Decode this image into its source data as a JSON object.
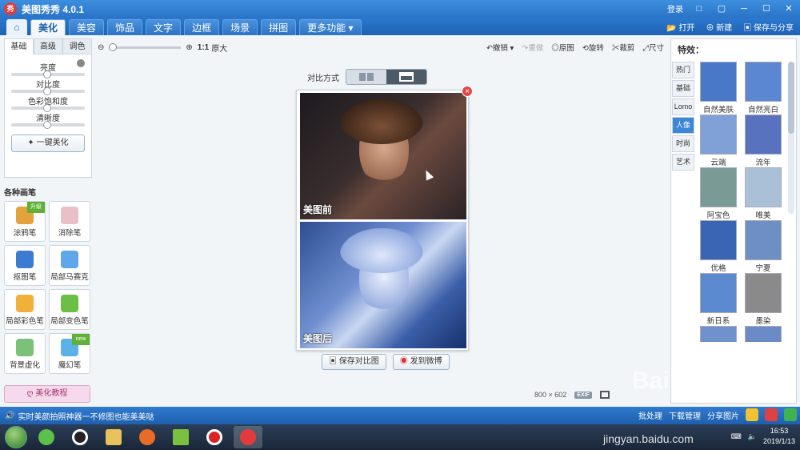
{
  "window": {
    "logo": "秀",
    "title": "美图秀秀 4.0.1",
    "login": "登录",
    "controls": [
      "□",
      "▢",
      "─",
      "☐",
      "✕"
    ]
  },
  "menu": {
    "home_icon": "home-icon",
    "tabs": [
      "美化",
      "美容",
      "饰品",
      "文字",
      "边框",
      "场景",
      "拼图",
      "更多功能"
    ],
    "active_tab": "美化",
    "open": "打开",
    "new": "新建",
    "save_share": "保存与分享"
  },
  "left": {
    "subtabs": [
      "基础",
      "高级",
      "调色"
    ],
    "sliders": [
      {
        "label": "亮度",
        "value": 0.5
      },
      {
        "label": "对比度",
        "value": 0.5
      },
      {
        "label": "色彩饱和度",
        "value": 0.5
      },
      {
        "label": "清晰度",
        "value": 0.5
      }
    ],
    "one_key": "一键美化",
    "brushes_title": "各种画笔",
    "brushes": [
      {
        "label": "涂鸦笔",
        "badge": "升级",
        "color": "#e3a23b"
      },
      {
        "label": "消除笔",
        "badge": "",
        "color": "#e8c1c8"
      },
      {
        "label": "抠图笔",
        "badge": "",
        "color": "#3b7bd0"
      },
      {
        "label": "局部马赛克",
        "badge": "",
        "color": "#5fa7e8"
      },
      {
        "label": "局部彩色笔",
        "badge": "",
        "color": "#f0b13a"
      },
      {
        "label": "局部变色笔",
        "badge": "",
        "color": "#6bbf45"
      },
      {
        "label": "背景虚化",
        "badge": "",
        "color": "#7cc17a"
      },
      {
        "label": "魔幻笔",
        "badge": "new",
        "color": "#5ab2e8"
      }
    ],
    "tutorial": "美化教程"
  },
  "toolbar": {
    "zoom_ratio": "1:1",
    "original_size": "原大",
    "undo": "撤销",
    "redo": "重做",
    "original": "原图",
    "rotate": "旋转",
    "crop": "裁剪",
    "size": "尺寸"
  },
  "compare": {
    "label": "对比方式",
    "before": "美图前",
    "after": "美图后",
    "save_compare": "保存对比图",
    "post_weibo": "发到微博",
    "image_size": "800 × 602",
    "exif": "EXIF"
  },
  "effects": {
    "title": "特效：",
    "categories": [
      "热门",
      "基础",
      "Lomo",
      "人像",
      "时尚",
      "艺术"
    ],
    "active_category": "人像",
    "items": [
      {
        "label": "自然美肤",
        "color": "#4a78c8"
      },
      {
        "label": "自然亮白",
        "color": "#5a86d2"
      },
      {
        "label": "云端",
        "color": "#7fa1d8"
      },
      {
        "label": "流年",
        "color": "#5872c0"
      },
      {
        "label": "阿宝色",
        "color": "#7a9a96"
      },
      {
        "label": "唯美",
        "color": "#a9c0d6"
      },
      {
        "label": "优格",
        "color": "#3a64b4"
      },
      {
        "label": "宁夏",
        "color": "#6e8fc4"
      },
      {
        "label": "新日系",
        "color": "#5c8ad0"
      },
      {
        "label": "墨染",
        "color": "#8a8a8a"
      },
      {
        "label": "",
        "color": "#6f92cf"
      },
      {
        "label": "",
        "color": "#6a8ac8"
      }
    ]
  },
  "status": {
    "message": "实时美颜拍照神器一不修图也能美美哒",
    "batch": "批处理",
    "download": "下载管理",
    "share": "分享图片"
  },
  "taskbar": {
    "time": "16:53",
    "date": "2019/1/13",
    "apps": [
      "360-icon",
      "qq-icon",
      "folder-icon",
      "firefox-icon",
      "media-icon",
      "record-icon",
      "meitu-icon"
    ]
  },
  "watermark": {
    "logo": "Bai 经验",
    "url": "jingyan.baidu.com"
  }
}
